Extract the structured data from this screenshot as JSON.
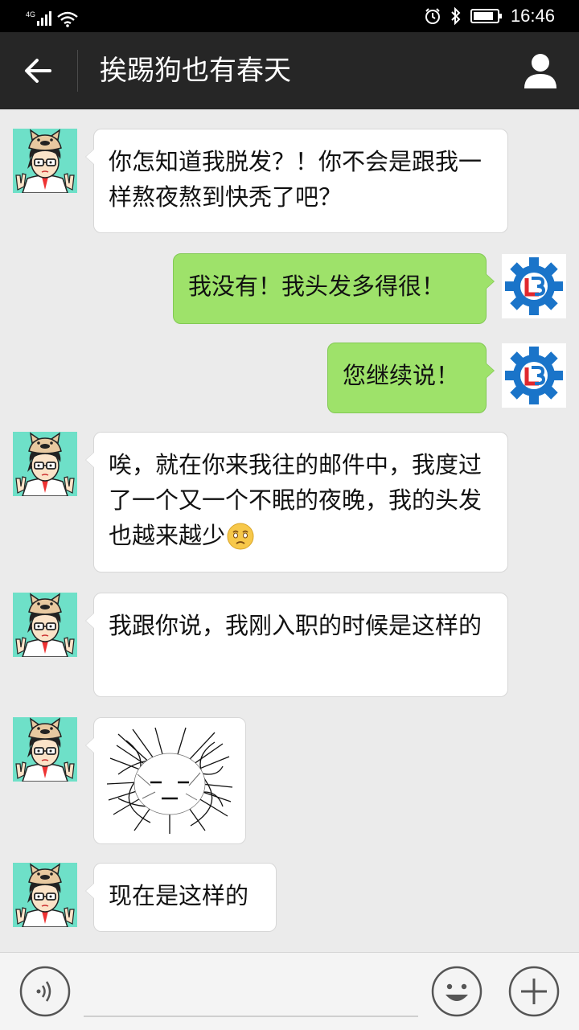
{
  "status_bar": {
    "network": "4G",
    "time": "16:46",
    "icons": [
      "signal-icon",
      "wifi-icon",
      "alarm-icon",
      "bluetooth-icon",
      "battery-icon"
    ]
  },
  "header": {
    "title": "挨踢狗也有春天",
    "icons": [
      "back-arrow-icon",
      "profile-icon"
    ]
  },
  "messages": [
    {
      "side": "left",
      "type": "text",
      "text": "你怎知道我脱发？！你不会是跟我一样熬夜熬到快秃了吧？"
    },
    {
      "side": "right",
      "type": "text",
      "text": "我没有！我头发多得很！"
    },
    {
      "side": "right",
      "type": "text",
      "text": "您继续说！"
    },
    {
      "side": "left",
      "type": "text",
      "text": "唉，就在你来我往的邮件中，我度过了一个又一个不眠的夜晚，我的头发也越来越少",
      "emoji": "sad-face-emoji"
    },
    {
      "side": "left",
      "type": "text",
      "text": "我跟你说，我刚入职的时候是这样的"
    },
    {
      "side": "left",
      "type": "image",
      "image": "messy-hair-sticker"
    },
    {
      "side": "left",
      "type": "text",
      "text": "现在是这样的"
    }
  ],
  "input_bar": {
    "placeholder": "",
    "icons": [
      "voice-icon",
      "emoji-icon",
      "plus-icon"
    ]
  },
  "colors": {
    "chat_background": "#ebebeb",
    "header_background": "#262626",
    "outgoing_bubble": "#9ee26a",
    "incoming_bubble": "#ffffff",
    "contact_avatar_background": "#6ee0c8",
    "logo_blue": "#1a74c9",
    "logo_red": "#e0282e"
  }
}
